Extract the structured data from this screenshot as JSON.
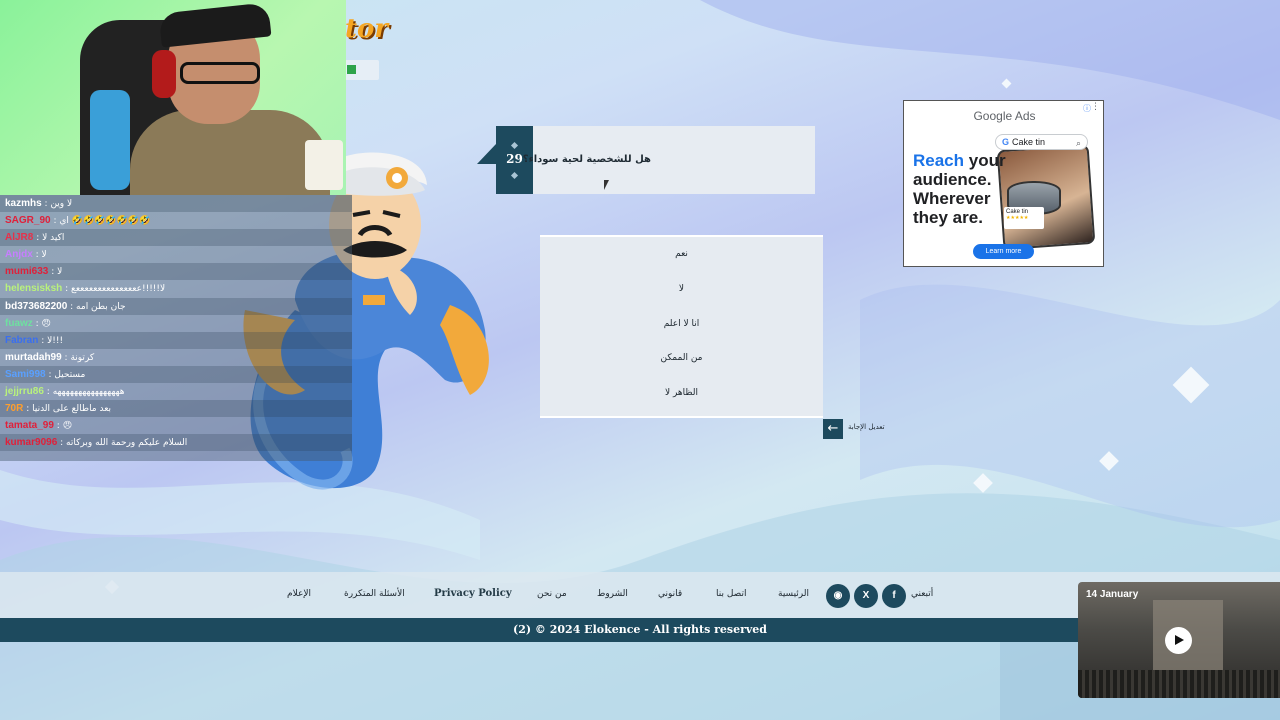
{
  "logo_fragment": "tor",
  "question": {
    "number": "29",
    "text": "هل للشخصية لحية سوداء؟"
  },
  "answers": [
    "نعم",
    "لا",
    "انا لا اعلم",
    "من الممكن",
    "الظاهر لا"
  ],
  "back": {
    "icon": "arrow-left-icon",
    "label": "تعديل الإجابة"
  },
  "chat": [
    {
      "user": "kazmhs",
      "msg": "لا وين",
      "color": "#ffffff"
    },
    {
      "user": "SAGR_90",
      "msg": "اي 🤣🤣🤣🤣🤣🤣🤣",
      "color": "#e0203a"
    },
    {
      "user": "AlJR8",
      "msg": "اكيد لا",
      "color": "#e8304a"
    },
    {
      "user": "Anjdx",
      "msg": "لا",
      "color": "#c77dff"
    },
    {
      "user": "mumi633",
      "msg": "لا",
      "color": "#e0203a"
    },
    {
      "user": "helensisksh",
      "msg": "لا!!!!!عععععععععععععععع",
      "color": "#b9f27c"
    },
    {
      "user": "bd373682200",
      "msg": "جان بطن امه",
      "color": "#ffffff"
    },
    {
      "user": "fuawz",
      "msg": "😠",
      "color": "#6ee0a0"
    },
    {
      "user": "Fabran",
      "msg": "لا!!!",
      "color": "#3a6ff0"
    },
    {
      "user": "murtadah99",
      "msg": "كرتونة",
      "color": "#ffffff"
    },
    {
      "user": "Sami998",
      "msg": "مستحيل",
      "color": "#5aa0ff"
    },
    {
      "user": "jejjrru86",
      "msg": "ههههههههههههههههه",
      "color": "#b9f27c"
    },
    {
      "user": "70R",
      "msg": "بعد ماطالع على الدنيا",
      "color": "#ff9e2c"
    },
    {
      "user": "tamata_99",
      "msg": "😠",
      "color": "#e0203a"
    },
    {
      "user": "kumar9096",
      "msg": "السلام عليكم ورحمة الله وبركاته",
      "color": "#e0203a"
    }
  ],
  "ad": {
    "brand": "Google Ads",
    "info_icon": "info-icon",
    "search_query": "Cake tin",
    "headline_accent": "Reach",
    "headline_rest": "your audience. Wherever they are.",
    "product_label": "Cake tin",
    "product_rating": "★★★★★",
    "cta": "Learn more",
    "accent_color": "#1a73e8"
  },
  "footer": {
    "follow": "أتبعني",
    "social": [
      "facebook-icon",
      "x-icon",
      "reddit-icon"
    ],
    "links": {
      "home": "الرئيسية",
      "contact": "اتصل بنا",
      "legal": "قانوني",
      "terms": "الشروط",
      "about": "من نحن",
      "privacy": "Privacy Policy",
      "faq": "الأسئلة المتكررة",
      "media": "الإعلام"
    },
    "copyright": "(2)  © 2024 Elokence - All rights reserved"
  },
  "video": {
    "date": "14 January",
    "play_icon": "play-icon"
  },
  "colors": {
    "primary": "#1d4a5e",
    "panel": "#e6ebf1"
  }
}
